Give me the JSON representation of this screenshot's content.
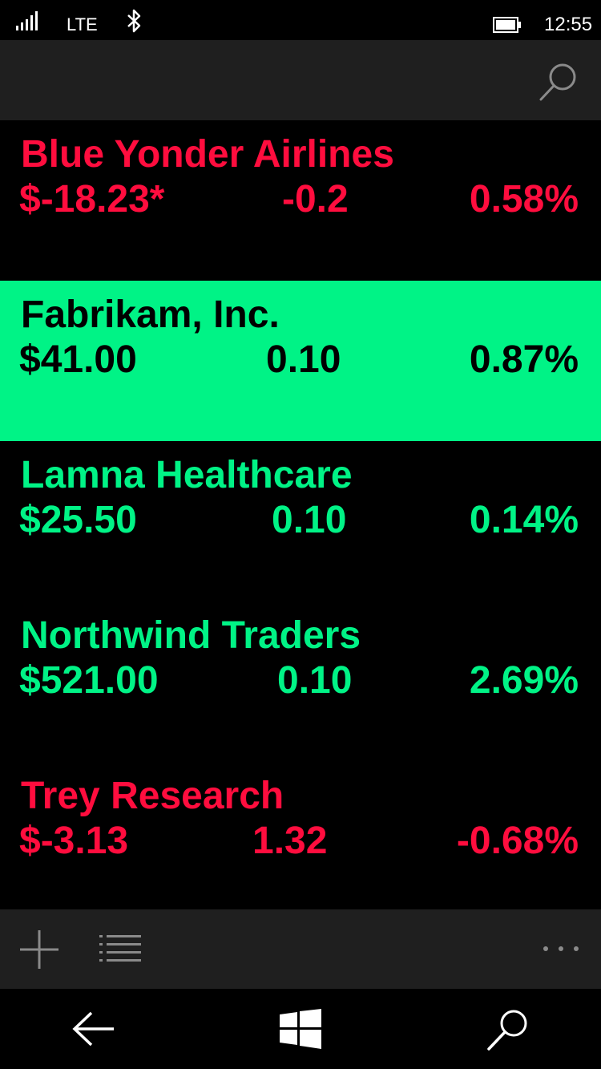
{
  "status_bar": {
    "network": "LTE",
    "time": "12:55"
  },
  "colors": {
    "up": "#00f386",
    "down": "#ff0d3e",
    "highlight_bg": "#00f386",
    "highlight_text": "#000000",
    "bar_bg": "#1f1f1f"
  },
  "stocks": [
    {
      "name": "Blue Yonder Airlines",
      "price": "$-18.23*",
      "change": "-0.2",
      "percent": "0.58%",
      "trend": "down",
      "selected": false
    },
    {
      "name": "Fabrikam, Inc.",
      "price": "$41.00",
      "change": "0.10",
      "percent": "0.87%",
      "trend": "up",
      "selected": true
    },
    {
      "name": "Lamna Healthcare",
      "price": "$25.50",
      "change": "0.10",
      "percent": "0.14%",
      "trend": "up",
      "selected": false
    },
    {
      "name": "Northwind Traders",
      "price": "$521.00",
      "change": "0.10",
      "percent": "2.69%",
      "trend": "up",
      "selected": false
    },
    {
      "name": "Trey Research",
      "price": "$-3.13",
      "change": "1.32",
      "percent": "-0.68%",
      "trend": "down",
      "selected": false
    }
  ],
  "icons": {
    "top_search": "search-icon",
    "add": "add-icon",
    "list": "list-icon",
    "more": "more-icon",
    "back": "back-arrow-icon",
    "home": "windows-logo-icon",
    "search": "search-icon"
  }
}
